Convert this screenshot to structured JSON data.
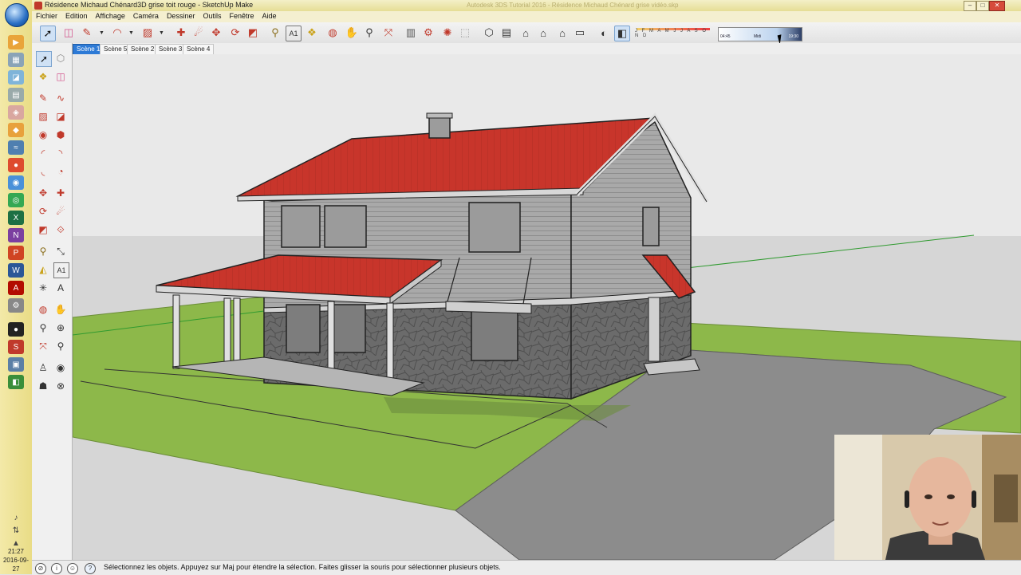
{
  "window": {
    "title": "Résidence Michaud Chénard3D grise toit rouge - SketchUp Make",
    "background_title": "Autodesk 3DS Tutorial 2016 - Résidence Michaud Chénard grise vidéo.skp",
    "controls": {
      "minimize": "–",
      "maximize": "□",
      "close": "✕"
    }
  },
  "menu": {
    "items": [
      "Fichier",
      "Edition",
      "Affichage",
      "Caméra",
      "Dessiner",
      "Outils",
      "Fenêtre",
      "Aide"
    ]
  },
  "toolbar": {
    "tools": [
      "select-icon",
      "eraser-icon",
      "pencil-icon",
      "arc-icon",
      "rectangle-icon",
      "push-pull-icon",
      "follow-me-icon",
      "rotate-icon",
      "move-icon",
      "scale-icon",
      "tape-measure-icon",
      "text-icon",
      "paint-bucket-icon",
      "orbit-icon",
      "pan-icon",
      "zoom-icon",
      "zoom-extents-icon",
      "component-icon",
      "warehouse-icon",
      "extension-icon",
      "3d-text-icon",
      "iso-view-icon",
      "top-view-icon",
      "front-view-icon",
      "right-view-icon",
      "back-view-icon",
      "left-view-icon",
      "shadows-icon",
      "fog-icon"
    ],
    "shadow_months": "J F M A M J J A S O N D",
    "time_left": "04:45",
    "time_mid": "Midi",
    "time_right": "19:30"
  },
  "scenes": {
    "tabs": [
      "Scène 1",
      "Scène 5",
      "Scène 2",
      "Scène 3",
      "Scène 4"
    ],
    "active": "Scène 1"
  },
  "palette": {
    "tools": [
      "select-icon",
      "component-icon",
      "paint-bucket-icon",
      "eraser-icon",
      "line-icon",
      "freehand-icon",
      "rectangle-icon",
      "rotated-rectangle-icon",
      "circle-icon",
      "polygon-icon",
      "arc-icon",
      "two-point-arc-icon",
      "three-point-arc-icon",
      "pie-icon",
      "move-icon",
      "push-pull-icon",
      "rotate-icon",
      "follow-me-icon",
      "scale-icon",
      "offset-icon",
      "tape-measure-icon",
      "dimension-icon",
      "protractor-icon",
      "text-icon",
      "axes-icon",
      "3d-text-icon",
      "orbit-icon",
      "pan-icon",
      "zoom-icon",
      "zoom-window-icon",
      "zoom-extents-icon",
      "previous-view-icon",
      "position-camera-icon",
      "look-around-icon",
      "walk-icon",
      "section-plane-icon"
    ]
  },
  "status": {
    "text": "Sélectionnez les objets. Appuyez sur Maj pour étendre la sélection. Faites glisser la souris pour sélectionner plusieurs objets."
  },
  "taskbar": {
    "apps": [
      "chrome-icon",
      "excel-icon",
      "onenote-icon",
      "powerpoint-icon",
      "word-icon",
      "acrobat-icon",
      "sketchup-icon"
    ],
    "time": "21:27",
    "date": "2016-09-27"
  },
  "colors": {
    "roof": "#c8352b",
    "siding": "#a9a9a9",
    "stone": "#6b6b6b",
    "grass": "#8db84a",
    "sky": "#e9e9e9",
    "ground": "#d6d6d6",
    "driveway": "#8c8c8c",
    "active_tab": "#2d7ad6"
  }
}
